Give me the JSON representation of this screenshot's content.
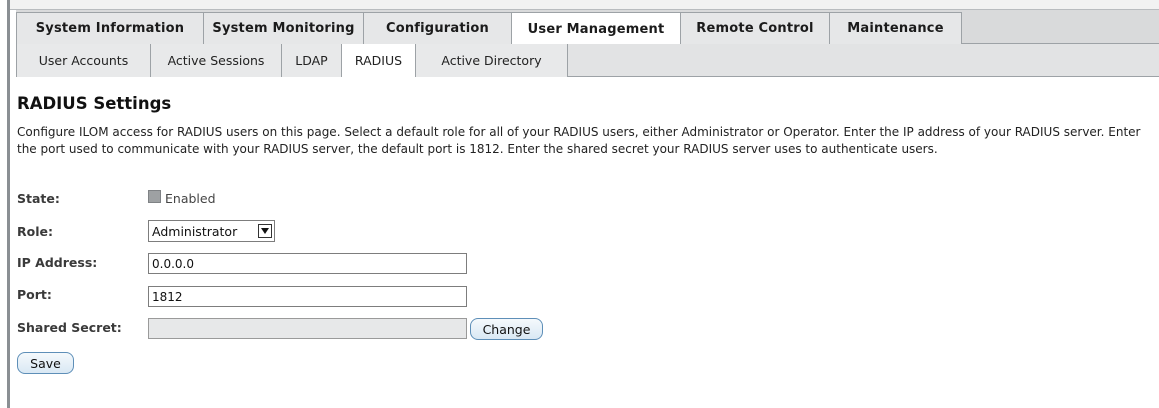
{
  "main_tabs": [
    {
      "label": "System Information"
    },
    {
      "label": "System Monitoring"
    },
    {
      "label": "Configuration"
    },
    {
      "label": "User Management"
    },
    {
      "label": "Remote Control"
    },
    {
      "label": "Maintenance"
    }
  ],
  "active_main_tab": "User Management",
  "sub_tabs": [
    {
      "label": "User Accounts"
    },
    {
      "label": "Active Sessions"
    },
    {
      "label": "LDAP"
    },
    {
      "label": "RADIUS"
    },
    {
      "label": "Active Directory"
    }
  ],
  "active_sub_tab": "RADIUS",
  "page": {
    "title": "RADIUS Settings",
    "description": "Configure ILOM access for RADIUS users on this page. Select a default role for all of your RADIUS users, either Administrator or Operator. Enter the IP address of your RADIUS server. Enter the port used to communicate with your RADIUS server, the default port is 1812. Enter the shared secret your RADIUS server uses to authenticate users."
  },
  "form": {
    "state_label": "State:",
    "state_checkbox_label": "Enabled",
    "state_checked": false,
    "role_label": "Role:",
    "role_value": "Administrator",
    "ip_label": "IP Address:",
    "ip_value": "0.0.0.0",
    "port_label": "Port:",
    "port_value": "1812",
    "secret_label": "Shared Secret:",
    "secret_value": "",
    "change_button": "Change",
    "save_button": "Save"
  }
}
